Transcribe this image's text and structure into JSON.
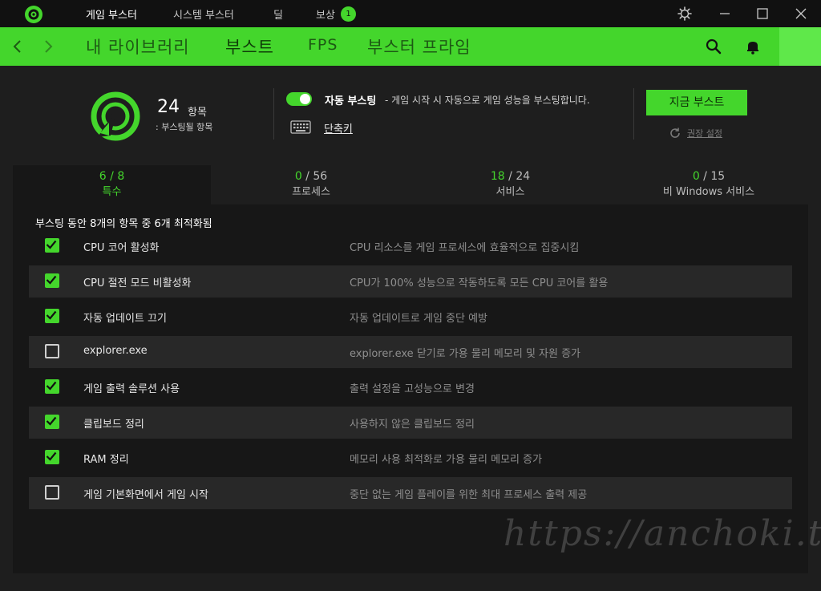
{
  "titlebar": {
    "tabs": [
      {
        "label": "게임 부스터",
        "active": true
      },
      {
        "label": "시스템 부스터",
        "active": false
      },
      {
        "label": "딜",
        "active": false
      },
      {
        "label": "보상",
        "active": false
      }
    ],
    "rewards_badge": "1"
  },
  "nav": {
    "items": [
      "내 라이브러리",
      "부스트",
      "FPS",
      "부스터 프라임"
    ],
    "active": "부스트"
  },
  "summary": {
    "count": "24",
    "count_unit": "항목",
    "count_sub": ": 부스팅될 항목",
    "auto_boost_label": "자동 부스팅",
    "auto_boost_desc": " - 게임 시작 시 자동으로 게임 성능을 부스팅합니다.",
    "auto_boost_on": true,
    "shortcut_label": "단축키",
    "boost_now": "지금 부스트",
    "recommended": "권장 설정"
  },
  "tabs": [
    {
      "checked": "6",
      "total": "8",
      "sep": " / ",
      "label": "특수",
      "active": true
    },
    {
      "checked": "0",
      "total": "56",
      "sep": " / ",
      "label": "프로세스",
      "active": false
    },
    {
      "checked": "18",
      "total": "24",
      "sep": " / ",
      "label": "서비스",
      "active": false
    },
    {
      "checked": "0",
      "total": "15",
      "sep": " / ",
      "label": "비 Windows 서비스",
      "active": false
    }
  ],
  "optimized_summary": "부스팅 동안 8개의 항목 중 6개 최적화됨",
  "rows": [
    {
      "name": "CPU 코어 활성화",
      "desc": "CPU 리소스를 게임 프로세스에 효율적으로 집중시킴",
      "checked": true
    },
    {
      "name": "CPU 절전 모드 비활성화",
      "desc": "CPU가 100% 성능으로 작동하도록 모든 CPU 코어를 활용",
      "checked": true
    },
    {
      "name": "자동 업데이트 끄기",
      "desc": "자동 업데이트로 게임 중단 예방",
      "checked": true
    },
    {
      "name": "explorer.exe",
      "desc": "explorer.exe 닫기로 가용 물리 메모리 및 자원 증가",
      "checked": false
    },
    {
      "name": "게임 출력 솔루션 사용",
      "desc": "출력 설정을 고성능으로 변경",
      "checked": true
    },
    {
      "name": "클립보드 정리",
      "desc": "사용하지 않은 클립보드 정리",
      "checked": true
    },
    {
      "name": "RAM 정리",
      "desc": "메모리 사용 최적화로 가용 물리 메모리 증가",
      "checked": true
    },
    {
      "name": "게임 기본화면에서 게임 시작",
      "desc": "중단 없는 게임 플레이를 위한 최대 프로세스 출력 제공",
      "checked": false
    }
  ],
  "watermark": "https://anchoki.tistory.com",
  "colors": {
    "accent": "#44d62c",
    "background": "#1e1e1e",
    "panel": "#171717",
    "titlebar": "#111111"
  }
}
